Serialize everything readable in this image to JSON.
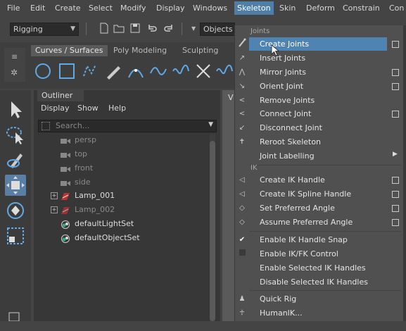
{
  "menubar": {
    "items": [
      "File",
      "Edit",
      "Create",
      "Select",
      "Modify",
      "Display",
      "Windows",
      "Skeleton",
      "Skin",
      "Deform",
      "Constrain",
      "Con"
    ],
    "active": "Skeleton"
  },
  "toolbar": {
    "mode_value": "Rigging",
    "objects_label": "Objects"
  },
  "shelf": {
    "tabs": [
      "Curves / Surfaces",
      "Poly Modeling",
      "Sculpting"
    ]
  },
  "outliner": {
    "tab": "Outliner",
    "menus": [
      "Display",
      "Show",
      "Help"
    ],
    "search_placeholder": "Search...",
    "rows": [
      "persp",
      "top",
      "front",
      "side",
      "Lamp_001",
      "Lamp_002",
      "defaultLightSet",
      "defaultObjectSet"
    ]
  },
  "viewport": {
    "label": "V"
  },
  "skeleton_menu": {
    "joints_section": "Joints",
    "ik_section": "IK",
    "items": [
      "Create Joints",
      "Insert Joints",
      "Mirror Joints",
      "Orient Joint",
      "Remove Joints",
      "Connect Joint",
      "Disconnect Joint",
      "Reroot Skeleton",
      "Joint Labelling",
      "Create IK Handle",
      "Create IK Spline Handle",
      "Set Preferred Angle",
      "Assume Preferred Angle",
      "Enable IK Handle Snap",
      "Enable IK/FK Control",
      "Enable Selected IK Handles",
      "Disable Selected IK Handles",
      "Quick Rig",
      "HumanIK..."
    ]
  },
  "colors": {
    "highlight": "#4f84b2",
    "accent": "#4f7fa6"
  }
}
